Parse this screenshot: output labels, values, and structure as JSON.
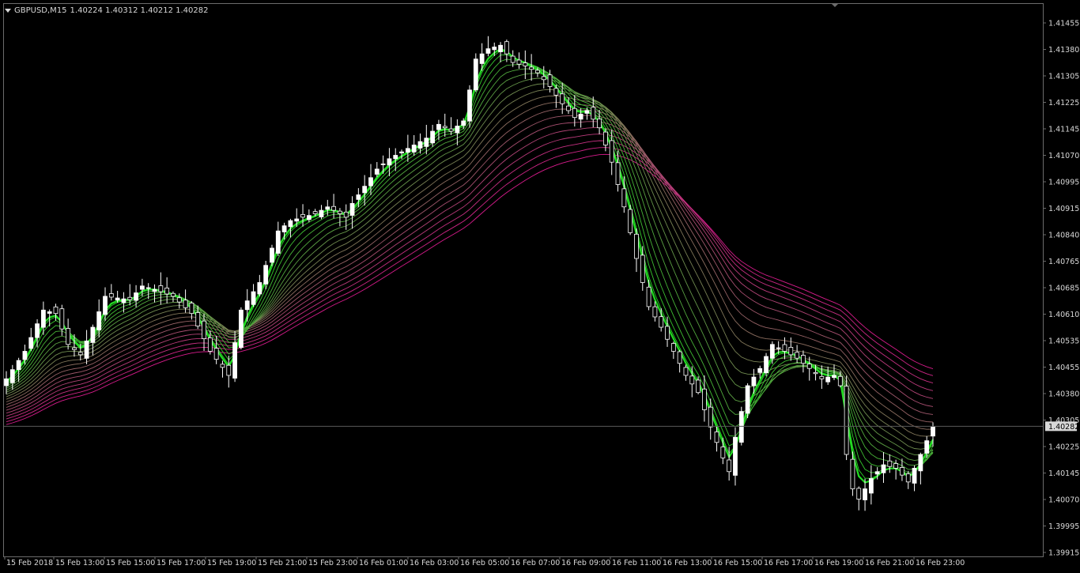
{
  "header": {
    "menu_icon": "triangle-down-icon",
    "symbol": "GBPUSD,M15",
    "ohlc": "1.40224 1.40312 1.40212 1.40282"
  },
  "colors": {
    "background": "#000000",
    "bull_candle": "#ffffff",
    "bear_candle": "#000000",
    "ribbon_fast": "#22dd22",
    "ribbon_slow": "#d81b8c",
    "axis_text": "#d8d8d8",
    "grid_border": "#6b6b6b",
    "bid_line": "#5a5a5a"
  },
  "chart_data": {
    "type": "line",
    "title": "GBPUSD,M15",
    "ylim": [
      1.3988,
      1.4153
    ],
    "y_ticks": [
      "1.41455",
      "1.41380",
      "1.41305",
      "1.41225",
      "1.41145",
      "1.41070",
      "1.40995",
      "1.40915",
      "1.40840",
      "1.40765",
      "1.40685",
      "1.40610",
      "1.40535",
      "1.40455",
      "1.40380",
      "1.40305",
      "1.40225",
      "1.40145",
      "1.40070",
      "1.39995",
      "1.39915"
    ],
    "x_ticks": [
      "15 Feb 2018",
      "15 Feb 13:00",
      "15 Feb 15:00",
      "15 Feb 17:00",
      "15 Feb 19:00",
      "15 Feb 21:00",
      "15 Feb 23:00",
      "16 Feb 01:00",
      "16 Feb 03:00",
      "16 Feb 05:00",
      "16 Feb 07:00",
      "16 Feb 09:00",
      "16 Feb 11:00",
      "16 Feb 13:00",
      "16 Feb 15:00",
      "16 Feb 17:00",
      "16 Feb 19:00",
      "16 Feb 21:00",
      "16 Feb 23:00"
    ],
    "current_price": "1.40282",
    "price_path": [
      [
        0,
        1.4042
      ],
      [
        3,
        1.405
      ],
      [
        6,
        1.4062
      ],
      [
        8,
        1.4061
      ],
      [
        10,
        1.4052
      ],
      [
        12,
        1.4049
      ],
      [
        14,
        1.4057
      ],
      [
        16,
        1.4066
      ],
      [
        20,
        1.4065
      ],
      [
        22,
        1.4069
      ],
      [
        24,
        1.4068
      ],
      [
        27,
        1.4066
      ],
      [
        30,
        1.4061
      ],
      [
        33,
        1.405
      ],
      [
        36,
        1.4043
      ],
      [
        38,
        1.4062
      ],
      [
        41,
        1.407
      ],
      [
        44,
        1.4085
      ],
      [
        46,
        1.4088
      ],
      [
        50,
        1.409
      ],
      [
        52,
        1.4092
      ],
      [
        55,
        1.4089
      ],
      [
        56,
        1.4093
      ],
      [
        58,
        1.4098
      ],
      [
        60,
        1.4103
      ],
      [
        62,
        1.4106
      ],
      [
        64,
        1.4108
      ],
      [
        66,
        1.411
      ],
      [
        68,
        1.4112
      ],
      [
        70,
        1.4116
      ],
      [
        72,
        1.4114
      ],
      [
        74,
        1.4117
      ],
      [
        76,
        1.4135
      ],
      [
        78,
        1.4138
      ],
      [
        80,
        1.4139
      ],
      [
        82,
        1.4134
      ],
      [
        84,
        1.4133
      ],
      [
        86,
        1.4131
      ],
      [
        88,
        1.4127
      ],
      [
        90,
        1.4122
      ],
      [
        92,
        1.4118
      ],
      [
        94,
        1.412
      ],
      [
        96,
        1.4115
      ],
      [
        98,
        1.4105
      ],
      [
        100,
        1.4092
      ],
      [
        102,
        1.4077
      ],
      [
        104,
        1.4063
      ],
      [
        106,
        1.4057
      ],
      [
        108,
        1.405
      ],
      [
        110,
        1.4043
      ],
      [
        112,
        1.4038
      ],
      [
        114,
        1.4028
      ],
      [
        116,
        1.4019
      ],
      [
        117,
        1.4015
      ],
      [
        118,
        1.4025
      ],
      [
        120,
        1.404
      ],
      [
        122,
        1.4045
      ],
      [
        124,
        1.4052
      ],
      [
        126,
        1.405
      ],
      [
        128,
        1.4048
      ],
      [
        130,
        1.4045
      ],
      [
        132,
        1.4042
      ],
      [
        134,
        1.4043
      ],
      [
        135,
        1.404
      ],
      [
        136,
        1.402
      ],
      [
        137,
        1.401
      ],
      [
        138,
        1.4007
      ],
      [
        140,
        1.4013
      ],
      [
        142,
        1.4017
      ],
      [
        144,
        1.4016
      ],
      [
        146,
        1.4012
      ],
      [
        148,
        1.402
      ],
      [
        150,
        1.4028
      ]
    ],
    "ribbon": {
      "lines": 20,
      "fast_period": 3,
      "slow_period": 60
    }
  }
}
